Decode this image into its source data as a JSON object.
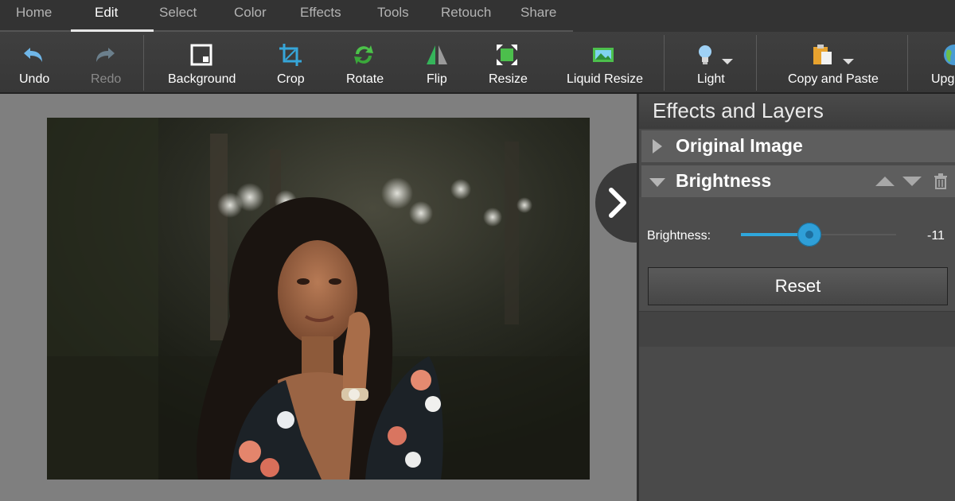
{
  "menu": {
    "tabs": [
      {
        "label": "Home"
      },
      {
        "label": "Edit"
      },
      {
        "label": "Select"
      },
      {
        "label": "Color"
      },
      {
        "label": "Effects"
      },
      {
        "label": "Tools"
      },
      {
        "label": "Retouch"
      },
      {
        "label": "Share"
      }
    ],
    "active": "Edit"
  },
  "toolbar": {
    "undo": {
      "label": "Undo",
      "icon": "undo-icon"
    },
    "redo": {
      "label": "Redo",
      "icon": "redo-icon"
    },
    "background": {
      "label": "Background",
      "icon": "background-icon"
    },
    "crop": {
      "label": "Crop",
      "icon": "crop-icon"
    },
    "rotate": {
      "label": "Rotate",
      "icon": "rotate-icon"
    },
    "flip": {
      "label": "Flip",
      "icon": "flip-icon"
    },
    "resize": {
      "label": "Resize",
      "icon": "resize-icon"
    },
    "liquid_resize": {
      "label": "Liquid Resize",
      "icon": "liquid-resize-icon"
    },
    "light": {
      "label": "Light",
      "icon": "lightbulb-icon"
    },
    "copy_paste": {
      "label": "Copy and Paste",
      "icon": "clipboard-icon"
    },
    "upgrade": {
      "label": "Upg",
      "icon": "globe-icon"
    }
  },
  "panel": {
    "title": "Effects and Layers",
    "layers": [
      {
        "name": "Original Image",
        "expanded": false
      },
      {
        "name": "Brightness",
        "expanded": true
      }
    ],
    "brightness": {
      "label": "Brightness:",
      "value": "-11",
      "slider_fraction": 0.44
    },
    "reset_label": "Reset"
  },
  "colors": {
    "accent": "#2fa7dc",
    "toolbar_bg": "#3b3b3b",
    "panel_bg": "#4a4a4a"
  }
}
